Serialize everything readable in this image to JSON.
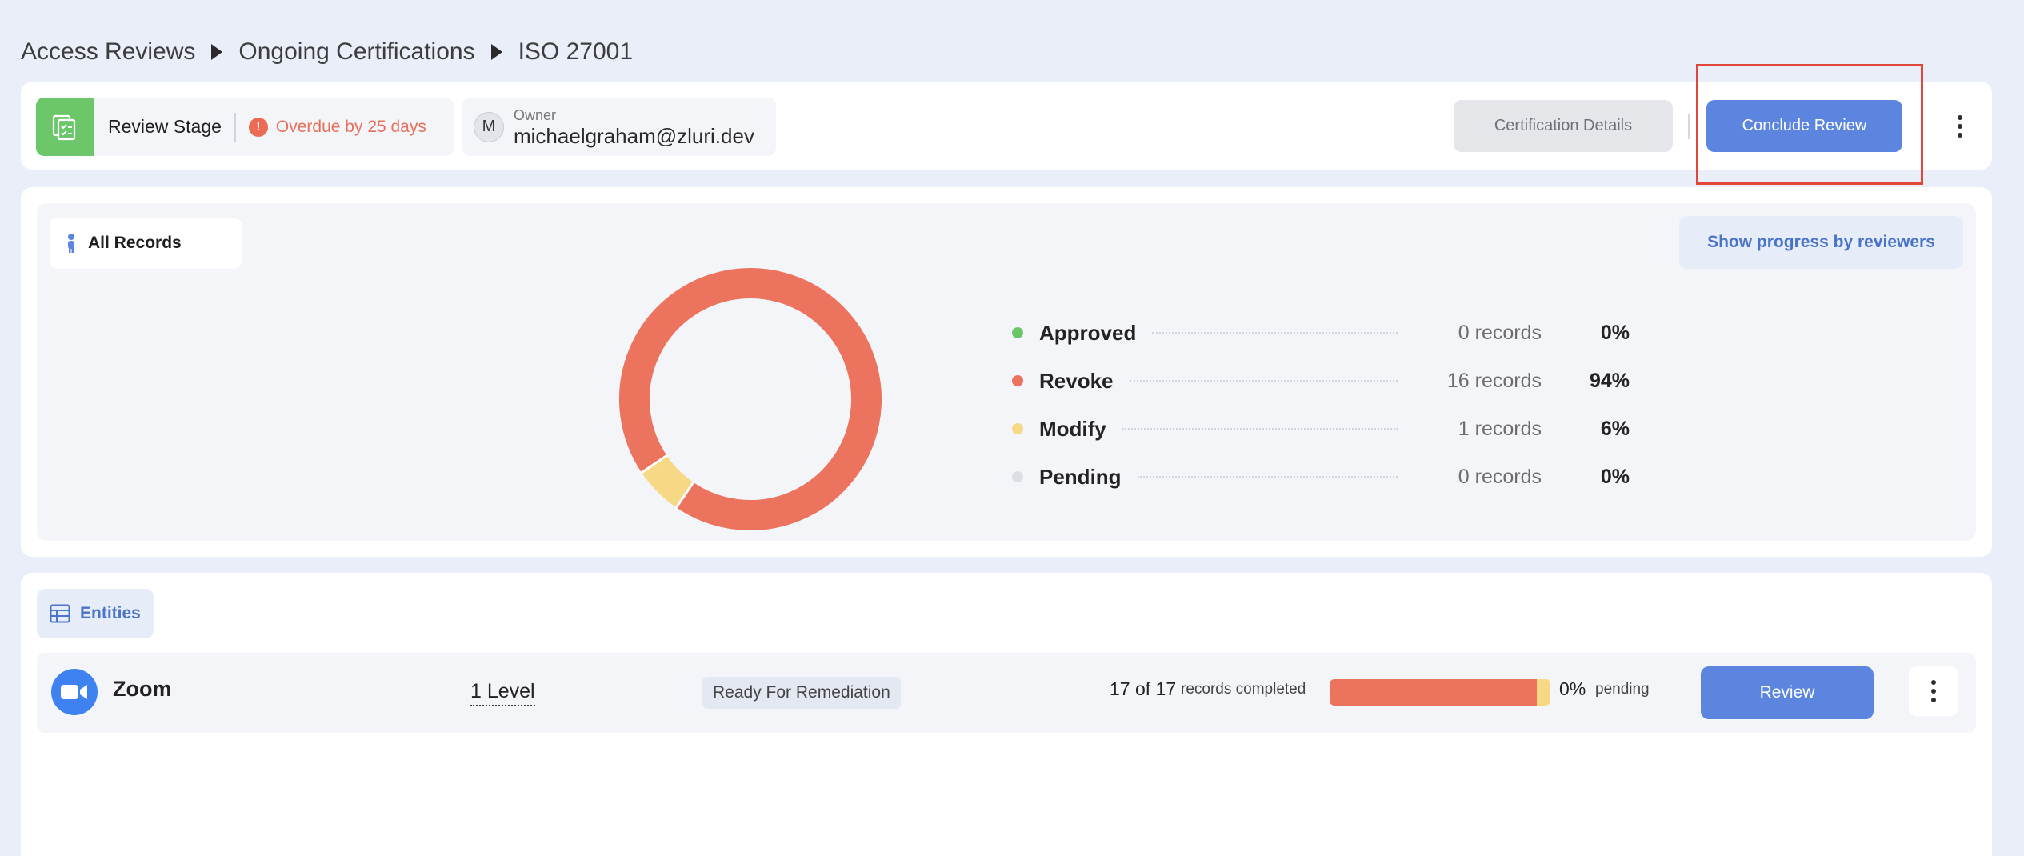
{
  "breadcrumb": {
    "items": [
      "Access Reviews",
      "Ongoing Certifications",
      "ISO 27001"
    ]
  },
  "header": {
    "stage_label": "Review Stage",
    "overdue_text": "Overdue by 25 days",
    "owner_caption": "Owner",
    "owner_initial": "M",
    "owner_email": "michaelgraham@zluri.dev",
    "certification_details_label": "Certification Details",
    "conclude_review_label": "Conclude Review"
  },
  "progress": {
    "filter_label": "All Records",
    "show_progress_label": "Show progress by reviewers",
    "legend": [
      {
        "label": "Approved",
        "count": "0 records",
        "pct": "0%",
        "color": "#6cc46b"
      },
      {
        "label": "Revoke",
        "count": "16 records",
        "pct": "94%",
        "color": "#ec735e"
      },
      {
        "label": "Modify",
        "count": "1 records",
        "pct": "6%",
        "color": "#f6d885"
      },
      {
        "label": "Pending",
        "count": "0 records",
        "pct": "0%",
        "color": "#dcdee3"
      }
    ],
    "donut": {
      "revoke_fraction": 0.94,
      "modify_fraction": 0.06
    }
  },
  "entities": {
    "tab_label": "Entities",
    "rows": [
      {
        "app_name": "Zoom",
        "level": "1 Level",
        "status": "Ready For Remediation",
        "completed_count": "17 of 17",
        "completed_label": "records completed",
        "pending_pct": "0%",
        "pending_label": "pending",
        "review_label": "Review",
        "bar": {
          "revoke_fraction": 0.94,
          "modify_fraction": 0.06
        }
      }
    ]
  },
  "colors": {
    "accent": "#5c85e0",
    "revoke": "#ec735e",
    "modify": "#f6d885",
    "approved": "#6cc46b",
    "pending": "#dcdee3",
    "overdue": "#e8705a"
  }
}
